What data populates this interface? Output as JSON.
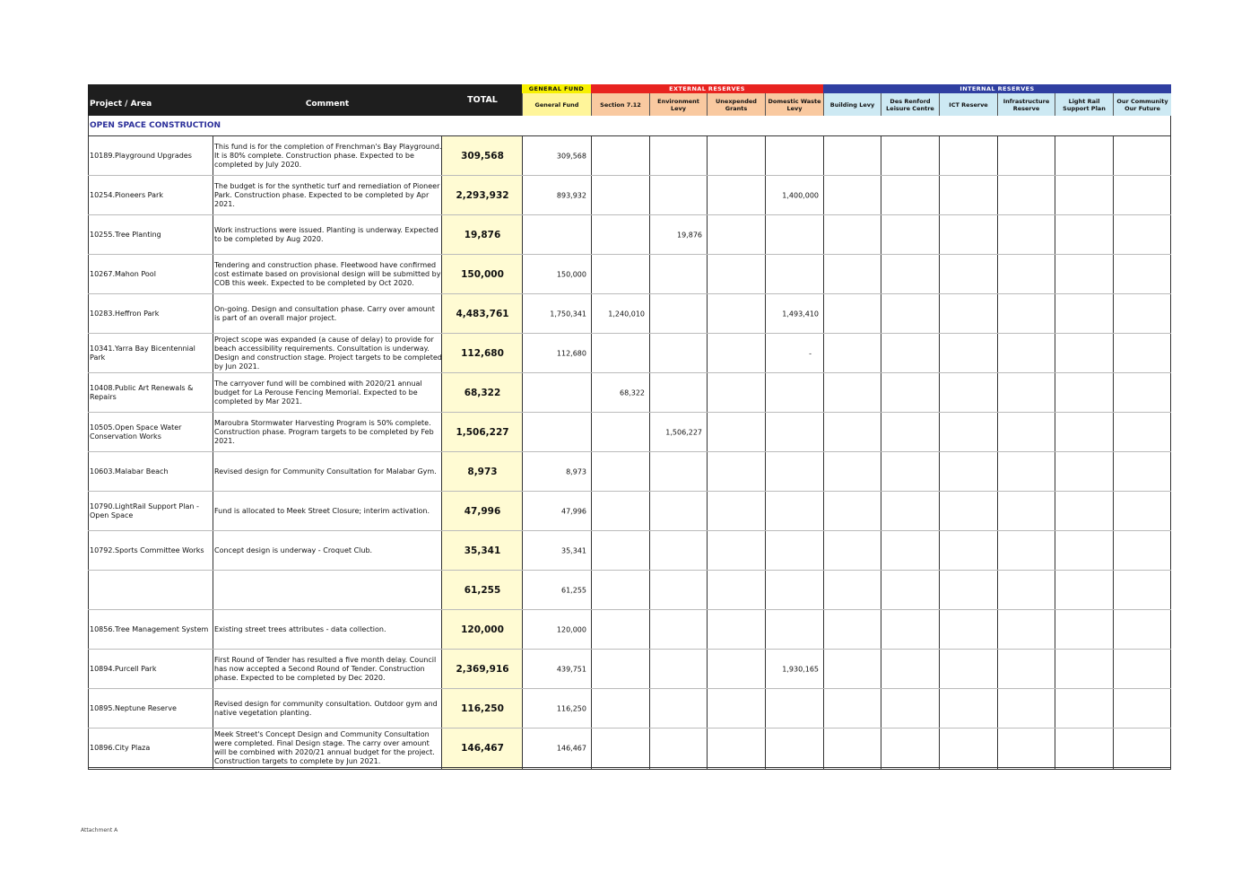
{
  "header": {
    "project_label": "Project / Area",
    "comment_label": "Comment",
    "total_label": "TOTAL",
    "groups": [
      {
        "label": "GENERAL FUND",
        "color": "#f7f000"
      },
      {
        "label": "EXTERNAL RESERVES",
        "color": "#e8231f"
      },
      {
        "label": "INTERNAL RESERVES",
        "color": "#2f3fa1"
      }
    ],
    "columns": [
      {
        "label": "General Fund",
        "color": "#fff59a"
      },
      {
        "label": "Section 7.12",
        "color": "#f9c9a0"
      },
      {
        "label": "Environment Levy",
        "color": "#f9c9a0"
      },
      {
        "label": "Unexpended Grants",
        "color": "#f9c9a0"
      },
      {
        "label": "Domestic Waste Levy",
        "color": "#f9c9a0"
      },
      {
        "label": "Building Levy",
        "color": "#cde9f3"
      },
      {
        "label": "Des Renford Leisure Centre",
        "color": "#cde9f3"
      },
      {
        "label": "ICT Reserve",
        "color": "#cde9f3"
      },
      {
        "label": "Infrastructure Reserve",
        "color": "#cde9f3"
      },
      {
        "label": "Light Rail Support Plan",
        "color": "#cde9f3"
      },
      {
        "label": "Our Community Our Future",
        "color": "#cde9f3"
      }
    ]
  },
  "section_title": "OPEN SPACE CONSTRUCTION",
  "rows": [
    {
      "project": "10189.Playground Upgrades",
      "comment": "This fund is for the completion of Frenchman's Bay Playground. It is 80% complete. Construction phase. Expected to be completed by July 2020.",
      "total": "309,568",
      "gf": "309,568",
      "s712": "",
      "env": "",
      "ug": "",
      "dwl": ""
    },
    {
      "project": "10254.Pioneers Park",
      "comment": "The budget is for the synthetic turf and remediation of Pioneer Park. Construction phase. Expected to be completed by Apr 2021.",
      "total": "2,293,932",
      "gf": "893,932",
      "s712": "",
      "env": "",
      "ug": "",
      "dwl": "1,400,000"
    },
    {
      "project": "10255.Tree Planting",
      "comment": "Work instructions were issued. Planting is underway. Expected to be completed by Aug 2020.",
      "total": "19,876",
      "gf": "",
      "s712": "",
      "env": "19,876",
      "ug": "",
      "dwl": ""
    },
    {
      "project": "10267.Mahon Pool",
      "comment": "Tendering and construction phase. Fleetwood have confirmed cost estimate based on provisional design will be submitted by COB this week. Expected to be completed by Oct 2020.",
      "total": "150,000",
      "gf": "150,000",
      "s712": "",
      "env": "",
      "ug": "",
      "dwl": ""
    },
    {
      "project": "10283.Heffron Park",
      "comment": "On-going. Design and consultation phase. Carry over amount is part of an overall major project.",
      "total": "4,483,761",
      "gf": "1,750,341",
      "s712": "1,240,010",
      "env": "",
      "ug": "",
      "dwl": "1,493,410"
    },
    {
      "project": "10341.Yarra Bay Bicentennial Park",
      "comment": "Project scope was expanded (a cause of delay) to provide for beach accessibility requirements. Consultation is underway. Design and construction stage. Project targets to be completed by Jun 2021.",
      "total": "112,680",
      "gf": "112,680",
      "s712": "",
      "env": "",
      "ug": "",
      "dwl": "-"
    },
    {
      "project": "10408.Public Art Renewals & Repairs",
      "comment": "The carryover fund will be combined with 2020/21 annual budget for La Perouse Fencing Memorial. Expected to be completed by Mar 2021.",
      "total": "68,322",
      "gf": "",
      "s712": "68,322",
      "env": "",
      "ug": "",
      "dwl": ""
    },
    {
      "project": "10505.Open Space Water Conservation Works",
      "comment": "Maroubra Stormwater Harvesting Program is 50% complete. Construction phase. Program targets to be completed by Feb 2021.",
      "total": "1,506,227",
      "gf": "",
      "s712": "",
      "env": "1,506,227",
      "ug": "",
      "dwl": ""
    },
    {
      "project": "10603.Malabar Beach",
      "comment": "Revised design for Community Consultation for Malabar Gym.",
      "total": "8,973",
      "gf": "8,973",
      "s712": "",
      "env": "",
      "ug": "",
      "dwl": ""
    },
    {
      "project": "10790.LightRail Support Plan -Open Space",
      "comment": "Fund is allocated to Meek Street Closure; interim activation.",
      "total": "47,996",
      "gf": "47,996",
      "s712": "",
      "env": "",
      "ug": "",
      "dwl": ""
    },
    {
      "project": "10792.Sports Committee Works",
      "comment": "Concept design is underway - Croquet Club.",
      "total": "35,341",
      "gf": "35,341",
      "s712": "",
      "env": "",
      "ug": "",
      "dwl": ""
    },
    {
      "project": "",
      "comment": "",
      "total": "61,255",
      "gf": "61,255",
      "s712": "",
      "env": "",
      "ug": "",
      "dwl": ""
    },
    {
      "project": "10856.Tree Management System",
      "comment": "Existing street trees attributes - data collection.",
      "total": "120,000",
      "gf": "120,000",
      "s712": "",
      "env": "",
      "ug": "",
      "dwl": ""
    },
    {
      "project": "10894.Purcell Park",
      "comment": "First Round of Tender has resulted a five month delay. Council has now accepted a Second Round of Tender. Construction phase. Expected to be completed by Dec 2020.",
      "total": "2,369,916",
      "gf": "439,751",
      "s712": "",
      "env": "",
      "ug": "",
      "dwl": "1,930,165"
    },
    {
      "project": "10895.Neptune Reserve",
      "comment": "Revised design for community consultation. Outdoor gym and native vegetation planting.",
      "total": "116,250",
      "gf": "116,250",
      "s712": "",
      "env": "",
      "ug": "",
      "dwl": ""
    },
    {
      "project": "10896.City Plaza",
      "comment": "Meek Street's Concept Design and Community Consultation were completed. Final Design stage. The carry over amount will be combined with 2020/21 annual budget for the project. Construction targets to complete by Jun 2021.",
      "total": "146,467",
      "gf": "146,467",
      "s712": "",
      "env": "",
      "ug": "",
      "dwl": ""
    }
  ],
  "footer": "Attachment A",
  "colors": {
    "header_dark": "#1e1e1e",
    "total_fill": "#fffbd3",
    "section_title": "#2b2f9a"
  }
}
